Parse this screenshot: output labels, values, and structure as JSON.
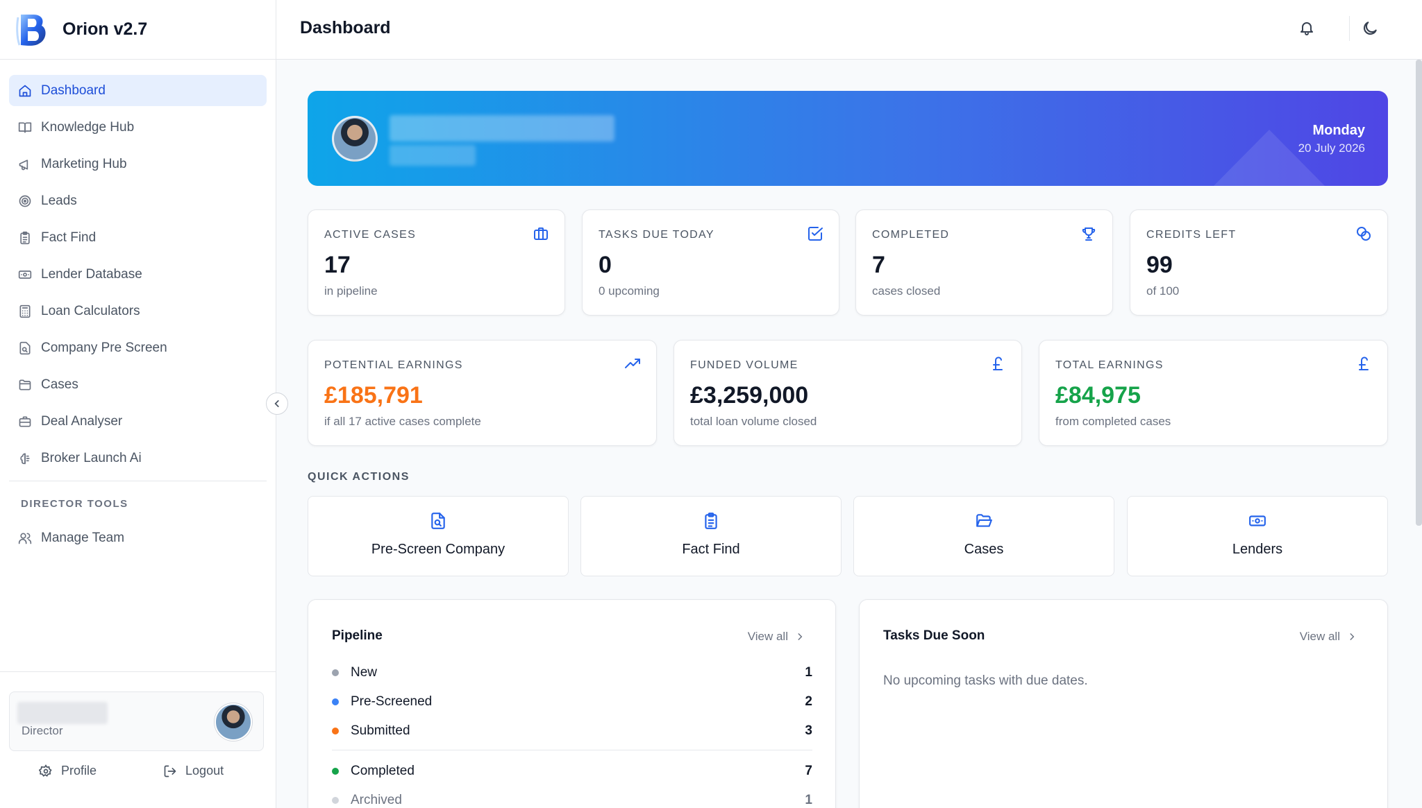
{
  "app": {
    "title": "Orion v2.7"
  },
  "sidebar": {
    "items": [
      {
        "label": "Dashboard",
        "icon": "home-icon",
        "active": true
      },
      {
        "label": "Knowledge Hub",
        "icon": "book-icon"
      },
      {
        "label": "Marketing Hub",
        "icon": "megaphone-icon"
      },
      {
        "label": "Leads",
        "icon": "target-icon"
      },
      {
        "label": "Fact Find",
        "icon": "clipboard-icon"
      },
      {
        "label": "Lender Database",
        "icon": "banknote-icon"
      },
      {
        "label": "Loan Calculators",
        "icon": "calculator-icon"
      },
      {
        "label": "Company Pre Screen",
        "icon": "file-search-icon"
      },
      {
        "label": "Cases",
        "icon": "folder-icon"
      },
      {
        "label": "Deal Analyser",
        "icon": "briefcase-icon"
      },
      {
        "label": "Broker Launch Ai",
        "icon": "brain-icon"
      }
    ],
    "section_title": "DIRECTOR TOOLS",
    "director_items": [
      {
        "label": "Manage Team",
        "icon": "users-icon"
      }
    ],
    "user": {
      "role": "Director"
    },
    "footer": {
      "profile_label": "Profile",
      "logout_label": "Logout"
    }
  },
  "header": {
    "title": "Dashboard"
  },
  "welcome": {
    "day": "Monday",
    "date": "20 July 2026"
  },
  "stats": [
    {
      "label": "ACTIVE CASES",
      "value": "17",
      "sub": "in pipeline",
      "icon": "briefcase-icon"
    },
    {
      "label": "TASKS DUE TODAY",
      "value": "0",
      "sub": "0 upcoming",
      "icon": "check-square-icon"
    },
    {
      "label": "COMPLETED",
      "value": "7",
      "sub": "cases closed",
      "icon": "trophy-icon"
    },
    {
      "label": "CREDITS LEFT",
      "value": "99",
      "sub": "of 100",
      "icon": "coins-icon"
    }
  ],
  "earnings": [
    {
      "label": "POTENTIAL EARNINGS",
      "value": "£185,791",
      "sub": "if all 17 active cases complete",
      "icon": "trending-up-icon",
      "color": "#f97316"
    },
    {
      "label": "FUNDED VOLUME",
      "value": "£3,259,000",
      "sub": "total loan volume closed",
      "icon": "pound-icon",
      "color": "#111827"
    },
    {
      "label": "TOTAL EARNINGS",
      "value": "£84,975",
      "sub": "from completed cases",
      "icon": "pound-icon",
      "color": "#16a34a"
    }
  ],
  "quick_actions": {
    "title": "QUICK ACTIONS",
    "items": [
      {
        "label": "Pre-Screen Company",
        "icon": "file-search-icon"
      },
      {
        "label": "Fact Find",
        "icon": "clipboard-icon"
      },
      {
        "label": "Cases",
        "icon": "folder-icon"
      },
      {
        "label": "Lenders",
        "icon": "banknote-icon"
      }
    ]
  },
  "pipeline": {
    "title": "Pipeline",
    "view_all": "View all",
    "rows": [
      {
        "label": "New",
        "count": "1",
        "color": "#9ca3af"
      },
      {
        "label": "Pre-Screened",
        "count": "2",
        "color": "#3b82f6"
      },
      {
        "label": "Submitted",
        "count": "3",
        "color": "#f97316"
      },
      {
        "label": "Completed",
        "count": "7",
        "color": "#16a34a"
      },
      {
        "label": "Archived",
        "count": "1",
        "color": "#d1d5db"
      }
    ]
  },
  "tasks": {
    "title": "Tasks Due Soon",
    "view_all": "View all",
    "empty": "No upcoming tasks with due dates."
  },
  "colors": {
    "accent": "#2563eb",
    "active_bg": "#e6effe"
  }
}
